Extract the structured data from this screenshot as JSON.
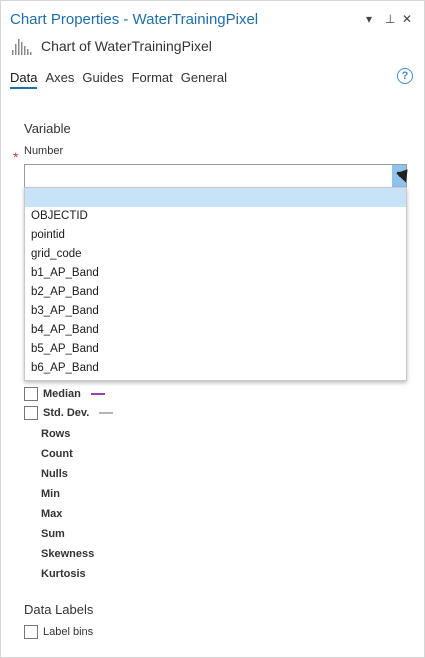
{
  "window": {
    "title": "Chart Properties - WaterTrainingPixel",
    "subtitle": "Chart of WaterTrainingPixel",
    "buttons": {
      "menu": "▾",
      "pin": "⊥",
      "close": "✕"
    }
  },
  "tabs": [
    {
      "label": "Data",
      "active": true
    },
    {
      "label": "Axes"
    },
    {
      "label": "Guides"
    },
    {
      "label": "Format"
    },
    {
      "label": "General"
    }
  ],
  "help_label": "?",
  "variable": {
    "heading": "Variable",
    "required_mark": "*",
    "field_label": "Number",
    "value": "",
    "options": [
      "",
      "OBJECTID",
      "pointid",
      "grid_code",
      "b1_AP_Band",
      "b2_AP_Band",
      "b3_AP_Band",
      "b4_AP_Band",
      "b5_AP_Band",
      "b6_AP_Band"
    ]
  },
  "statistics": {
    "median": {
      "label": "Median",
      "checked": false,
      "color": "#9b3fb5"
    },
    "std_dev": {
      "label": "Std. Dev.",
      "checked": false,
      "color": "#b5b5b5"
    },
    "items": [
      "Rows",
      "Count",
      "Nulls",
      "Min",
      "Max",
      "Sum",
      "Skewness",
      "Kurtosis"
    ]
  },
  "data_labels": {
    "heading": "Data Labels",
    "label_bins": {
      "label": "Label bins",
      "checked": false
    }
  }
}
